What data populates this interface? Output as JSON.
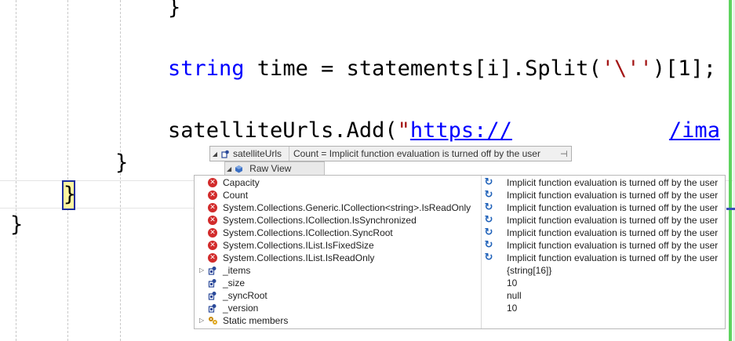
{
  "code": {
    "line_brace_top": "}",
    "line_string": {
      "keyword": "string",
      "rest": " time = statements[i].Split(",
      "char_literal": "'\\''",
      "tail": ")[1];"
    },
    "line_add": {
      "prefix": "satelliteUrls.Add(",
      "quote": "\"",
      "url_start": "https://",
      "url_end": "/ima"
    },
    "line_brace_inner": "}",
    "line_brace_current": "}",
    "line_brace_outer": "}"
  },
  "datatip": {
    "variable_name": "satelliteUrls",
    "value": "Count = Implicit function evaluation is turned off by the user",
    "pin_glyph": "⊣",
    "raw_view_label": "Raw View"
  },
  "members": [
    {
      "name": "Capacity",
      "icon": "error-icon",
      "value": "Implicit function evaluation is turned off by the user",
      "value_icon": "refresh-icon"
    },
    {
      "name": "Count",
      "icon": "error-icon",
      "value": "Implicit function evaluation is turned off by the user",
      "value_icon": "refresh-icon"
    },
    {
      "name": "System.Collections.Generic.ICollection<string>.IsReadOnly",
      "icon": "error-icon",
      "value": "Implicit function evaluation is turned off by the user",
      "value_icon": "refresh-icon"
    },
    {
      "name": "System.Collections.ICollection.IsSynchronized",
      "icon": "error-icon",
      "value": "Implicit function evaluation is turned off by the user",
      "value_icon": "refresh-icon"
    },
    {
      "name": "System.Collections.ICollection.SyncRoot",
      "icon": "error-icon",
      "value": "Implicit function evaluation is turned off by the user",
      "value_icon": "refresh-icon"
    },
    {
      "name": "System.Collections.IList.IsFixedSize",
      "icon": "error-icon",
      "value": "Implicit function evaluation is turned off by the user",
      "value_icon": "refresh-icon"
    },
    {
      "name": "System.Collections.IList.IsReadOnly",
      "icon": "error-icon",
      "value": "Implicit function evaluation is turned off by the user",
      "value_icon": "refresh-icon"
    },
    {
      "name": "_items",
      "icon": "private-field-icon",
      "value": "{string[16]}",
      "expandable": true
    },
    {
      "name": "_size",
      "icon": "private-field-icon",
      "value": "10"
    },
    {
      "name": "_syncRoot",
      "icon": "private-field-icon",
      "value": "null"
    },
    {
      "name": "_version",
      "icon": "private-field-icon",
      "value": "10"
    },
    {
      "name": "Static members",
      "icon": "static-members-icon",
      "value": "",
      "expandable": true
    }
  ],
  "colors": {
    "keyword": "#0000ff",
    "string": "#a31515",
    "error": "#d22b2b",
    "refresh": "#1c5fb8",
    "match_highlight": "#fff5a0",
    "match_border": "#1b2c9c"
  }
}
